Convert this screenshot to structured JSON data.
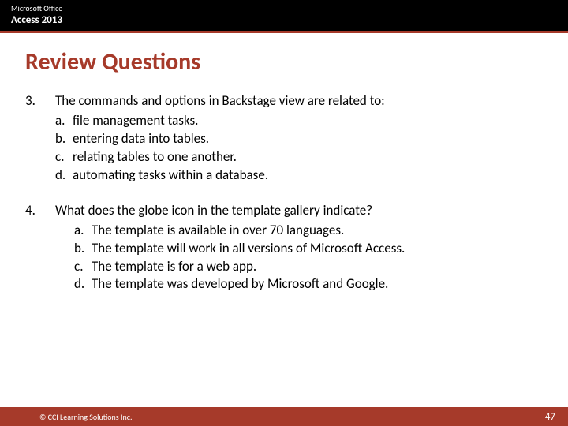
{
  "header": {
    "small": "Microsoft Office",
    "bold": "Access 2013"
  },
  "title": "Review Questions",
  "questions": [
    {
      "num": "3.",
      "stem": "The commands and options in Backstage view are related to:",
      "opts": [
        {
          "letter": "a.",
          "text": "file management tasks."
        },
        {
          "letter": "b.",
          "text": "entering data into tables."
        },
        {
          "letter": "c.",
          "text": "relating tables to one another."
        },
        {
          "letter": "d.",
          "text": "automating tasks within a database."
        }
      ]
    },
    {
      "num": "4.",
      "stem": "What does the globe icon in the template gallery indicate?",
      "opts": [
        {
          "letter": "a.",
          "text": "The template is available in over 70 languages."
        },
        {
          "letter": "b.",
          "text": "The template will work in all versions of Microsoft Access."
        },
        {
          "letter": "c.",
          "text": "The template is for a web app."
        },
        {
          "letter": "d.",
          "text": "The template was developed by Microsoft and Google."
        }
      ]
    }
  ],
  "footer": {
    "copyright": "© CCI Learning Solutions Inc.",
    "page": "47"
  }
}
